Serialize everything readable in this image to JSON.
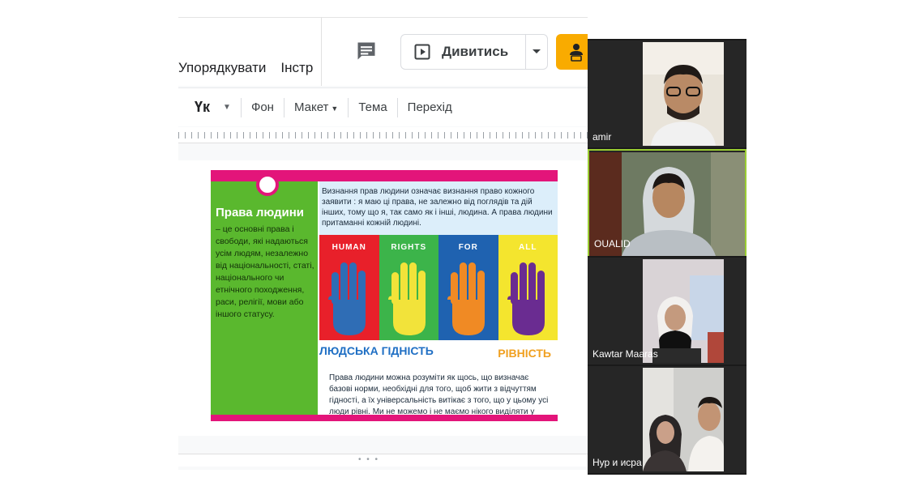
{
  "editor": {
    "menu": [
      "Упорядкувати",
      "Інстр"
    ],
    "watch_button": {
      "label": "Дивитись"
    },
    "toolbar": {
      "font": "Үк",
      "background": "Фон",
      "layout": "Макет",
      "theme": "Тема",
      "transition": "Перехід"
    }
  },
  "slide": {
    "title": "Права людини",
    "left_text": "– це основні права і свободи, які надаються усім людям, незалежно від національності, статі, національного чи етнічного походження, раси, релігії, мови або іншого статусу.",
    "top_text": "Визнання прав людини означає визнання право кожного заявити : я маю ці права, не залежно від поглядів та дій інших, тому що я, так само як і інші, людина. А права людини притаманні кожній людині.",
    "hands": [
      {
        "word": "HUMAN",
        "bg": "#e8202a",
        "hand": "#2f6db5"
      },
      {
        "word": "RIGHTS",
        "bg": "#3cb44a",
        "hand": "#f2e33a"
      },
      {
        "word": "FOR",
        "bg": "#1f62b0",
        "hand": "#f08a24"
      },
      {
        "word": "ALL",
        "bg": "#f4e52e",
        "hand": "#6a2c91"
      }
    ],
    "dignity": "ЛЮДСЬКА ГІДНІСТЬ",
    "equality": "РІВНІСТЬ",
    "bottom_text": "Права людини можна розуміти як щось, що визначає базові норми, необхідні для того, щоб жити з відчуттям гідності, а їх універсальність витікає з того, що у цьому усі люди рівні. Ми не можемо і не маємо нікого виділяти у"
  },
  "participants": [
    {
      "name": "amir",
      "active": false
    },
    {
      "name": "OUALID",
      "active": true
    },
    {
      "name": "Kawtar Maaras",
      "active": false
    },
    {
      "name": "Нур и исра",
      "active": false
    }
  ],
  "colors": {
    "magenta": "#e3157a",
    "slide_green": "#5ab82e",
    "share_yellow": "#f9ab00",
    "active_border": "#9acd32"
  }
}
